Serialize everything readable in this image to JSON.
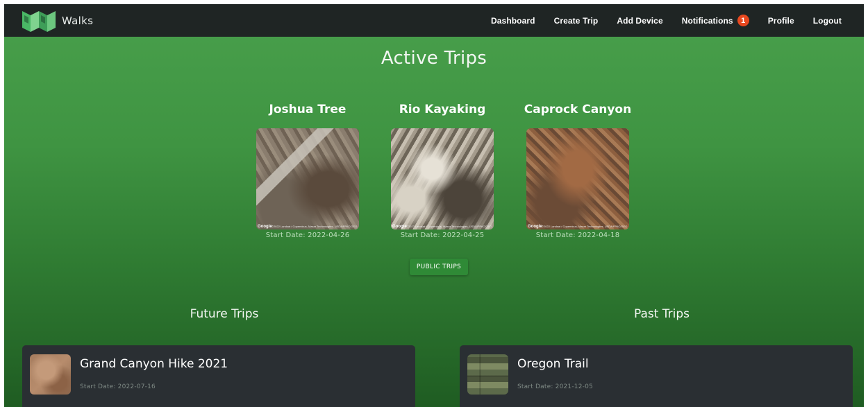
{
  "brand": {
    "name": "Walks"
  },
  "nav": {
    "dashboard": "Dashboard",
    "create_trip": "Create Trip",
    "add_device": "Add Device",
    "notifications": "Notifications",
    "notifications_count": "1",
    "profile": "Profile",
    "logout": "Logout"
  },
  "active": {
    "title": "Active Trips",
    "trips": [
      {
        "name": "Joshua Tree",
        "start_date": "Start Date: 2022-04-26"
      },
      {
        "name": "Rio Kayaking",
        "start_date": "Start Date: 2022-04-25"
      },
      {
        "name": "Caprock Canyon",
        "start_date": "Start Date: 2022-04-18"
      }
    ],
    "map_attribution": "Google",
    "map_copyright": "©2022 Landsat / Copernicus, Maxar Technologies, USDA/FPAC/GEO"
  },
  "public_trips_button": "PUBLIC TRIPS",
  "future": {
    "title": "Future Trips",
    "trips": [
      {
        "name": "Grand Canyon Hike 2021",
        "start_date": "Start Date: 2022-07-16"
      }
    ]
  },
  "past": {
    "title": "Past Trips",
    "trips": [
      {
        "name": "Oregon Trail",
        "start_date": "Start Date: 2021-12-05"
      }
    ]
  },
  "colors": {
    "navbar": "#1f2524",
    "background_top": "#49a04c",
    "background_bottom": "#1f5c22",
    "badge": "#e8481f",
    "card": "#2a2f33",
    "button": "#2f8a36"
  }
}
